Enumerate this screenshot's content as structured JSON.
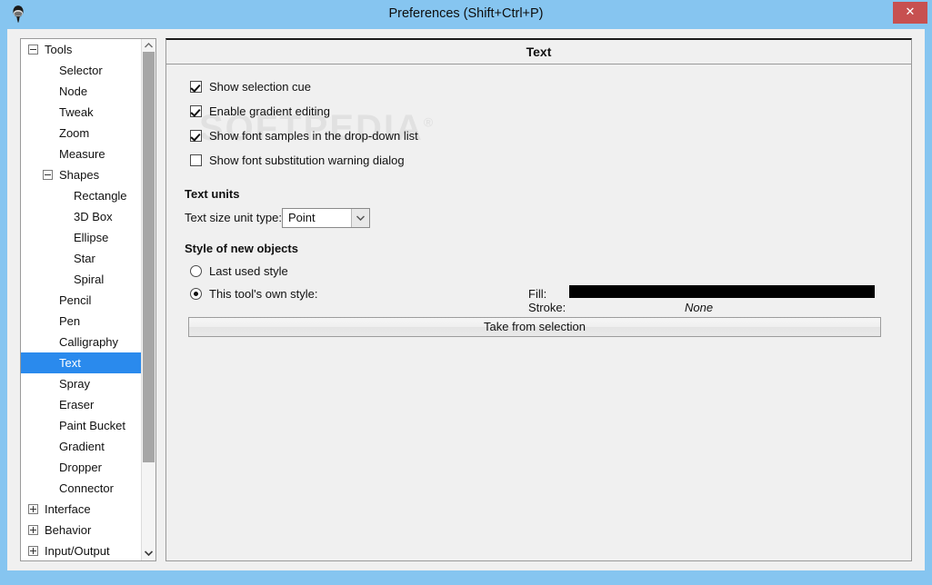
{
  "window": {
    "title": "Preferences (Shift+Ctrl+P)",
    "app_icon": "inkscape-logo-icon",
    "close_label": "✕",
    "titlebar_color": "#86c5f0",
    "close_color": "#c75050"
  },
  "sidebar": {
    "scrollbar": {
      "up_arrow": "chevron-up-icon",
      "down_arrow": "chevron-down-icon"
    },
    "items": [
      {
        "label": "Tools",
        "level": 0,
        "expander": "minus",
        "selected": false
      },
      {
        "label": "Selector",
        "level": 1,
        "expander": "none",
        "selected": false
      },
      {
        "label": "Node",
        "level": 1,
        "expander": "none",
        "selected": false
      },
      {
        "label": "Tweak",
        "level": 1,
        "expander": "none",
        "selected": false
      },
      {
        "label": "Zoom",
        "level": 1,
        "expander": "none",
        "selected": false
      },
      {
        "label": "Measure",
        "level": 1,
        "expander": "none",
        "selected": false
      },
      {
        "label": "Shapes",
        "level": 1,
        "expander": "minus",
        "selected": false
      },
      {
        "label": "Rectangle",
        "level": 2,
        "expander": "none",
        "selected": false
      },
      {
        "label": "3D Box",
        "level": 2,
        "expander": "none",
        "selected": false
      },
      {
        "label": "Ellipse",
        "level": 2,
        "expander": "none",
        "selected": false
      },
      {
        "label": "Star",
        "level": 2,
        "expander": "none",
        "selected": false
      },
      {
        "label": "Spiral",
        "level": 2,
        "expander": "none",
        "selected": false
      },
      {
        "label": "Pencil",
        "level": 1,
        "expander": "none",
        "selected": false
      },
      {
        "label": "Pen",
        "level": 1,
        "expander": "none",
        "selected": false
      },
      {
        "label": "Calligraphy",
        "level": 1,
        "expander": "none",
        "selected": false
      },
      {
        "label": "Text",
        "level": 1,
        "expander": "none",
        "selected": true
      },
      {
        "label": "Spray",
        "level": 1,
        "expander": "none",
        "selected": false
      },
      {
        "label": "Eraser",
        "level": 1,
        "expander": "none",
        "selected": false
      },
      {
        "label": "Paint Bucket",
        "level": 1,
        "expander": "none",
        "selected": false
      },
      {
        "label": "Gradient",
        "level": 1,
        "expander": "none",
        "selected": false
      },
      {
        "label": "Dropper",
        "level": 1,
        "expander": "none",
        "selected": false
      },
      {
        "label": "Connector",
        "level": 1,
        "expander": "none",
        "selected": false
      },
      {
        "label": "Interface",
        "level": 0,
        "expander": "plus",
        "selected": false
      },
      {
        "label": "Behavior",
        "level": 0,
        "expander": "plus",
        "selected": false
      },
      {
        "label": "Input/Output",
        "level": 0,
        "expander": "plus",
        "selected": false
      }
    ],
    "selected_color": "#2a8aed"
  },
  "panel": {
    "header": "Text",
    "watermark": "SOFTPEDIA",
    "watermark_mark": "®",
    "checkboxes": [
      {
        "label": "Show selection cue",
        "checked": true
      },
      {
        "label": "Enable gradient editing",
        "checked": true
      },
      {
        "label": "Show font samples in the drop-down list",
        "checked": true
      },
      {
        "label": "Show font substitution warning dialog",
        "checked": false
      }
    ],
    "text_units": {
      "title": "Text units",
      "field_label": "Text size unit type:",
      "selected_value": "Point",
      "dropdown_arrow": "chevron-down-icon"
    },
    "style_of_new_objects": {
      "title": "Style of new objects",
      "radios": [
        {
          "label": "Last used style",
          "selected": false
        },
        {
          "label": "This tool's own style:",
          "selected": true
        }
      ],
      "fill_label": "Fill:",
      "fill_color": "#000000",
      "stroke_label": "Stroke:",
      "stroke_value": "None",
      "take_button": "Take from selection"
    }
  }
}
